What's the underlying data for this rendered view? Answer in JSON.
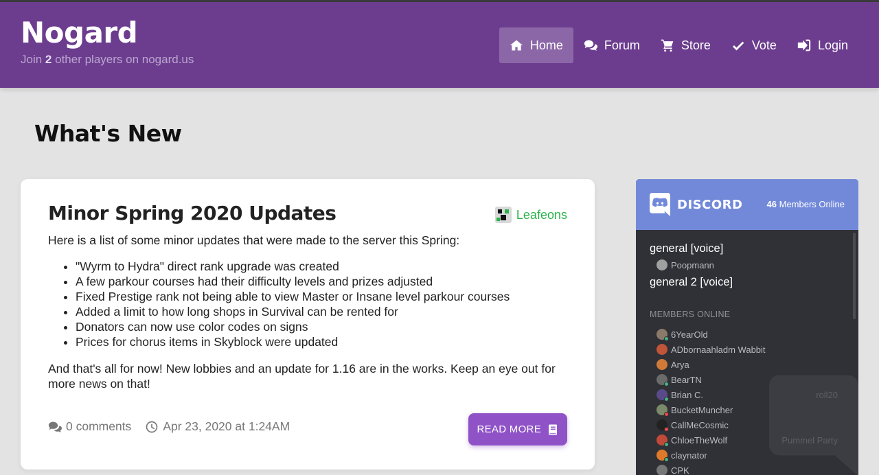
{
  "site": {
    "title": "Nogard",
    "sub_prefix": "Join",
    "player_count": "2",
    "sub_suffix": "other players on nogard.us"
  },
  "nav": [
    {
      "label": "Home",
      "icon": "home-icon",
      "active": true
    },
    {
      "label": "Forum",
      "icon": "comments-icon"
    },
    {
      "label": "Store",
      "icon": "cart-icon"
    },
    {
      "label": "Vote",
      "icon": "check-icon"
    },
    {
      "label": "Login",
      "icon": "sign-in-icon"
    }
  ],
  "page": {
    "heading": "What's New"
  },
  "post": {
    "title": "Minor Spring 2020 Updates",
    "author": "Leafeons",
    "intro": "Here is a list of some minor updates that were made to the server this Spring:",
    "items": [
      "\"Wyrm to Hydra\" direct rank upgrade was created",
      "A few parkour courses had their difficulty levels and prizes adjusted",
      "Fixed Prestige rank not being able to view Master or Insane level parkour courses",
      "Added a limit to how long shops in Survival can be rented for",
      "Donators can now use color codes on signs",
      "Prices for chorus items in Skyblock were updated"
    ],
    "outro": "And that's all for now! New lobbies and an update for 1.16 are in the works. Keep an eye out for more news on that!",
    "comments": "0 comments",
    "date": "Apr 23, 2020 at 1:24AM",
    "read_more": "READ MORE"
  },
  "discord": {
    "brand": "DISCORD",
    "online_count": "46",
    "online_label": "Members Online",
    "channels": [
      {
        "name": "general [voice]",
        "users": [
          "Poopmann"
        ]
      },
      {
        "name": "general 2 [voice]",
        "users": []
      }
    ],
    "members_label": "MEMBERS ONLINE",
    "members": [
      {
        "name": "6YearOld",
        "game": "",
        "avatar": "#8a7a6a",
        "status": "#43b581"
      },
      {
        "name": "ADbornaahladm Wabbit",
        "game": "",
        "avatar": "#c0553a",
        "status": ""
      },
      {
        "name": "Arya",
        "game": "",
        "avatar": "#d07a3a",
        "status": ""
      },
      {
        "name": "BearTN",
        "game": "",
        "avatar": "#6b6b6b",
        "status": "#43b581"
      },
      {
        "name": "Brian C.",
        "game": "roll20",
        "avatar": "#5a4a8a",
        "status": "#43b581"
      },
      {
        "name": "BucketMuncher",
        "game": "",
        "avatar": "#7a8a6a",
        "status": "#f04747"
      },
      {
        "name": "CallMeCosmic",
        "game": "",
        "avatar": "#222222",
        "status": "#f04747"
      },
      {
        "name": "ChloeTheWolf",
        "game": "Pummel Party",
        "avatar": "#c04a3a",
        "status": "#43b581"
      },
      {
        "name": "claynator",
        "game": "",
        "avatar": "#e07a2a",
        "status": "#43b581"
      },
      {
        "name": "CPK",
        "game": "",
        "avatar": "#777777",
        "status": ""
      }
    ]
  }
}
